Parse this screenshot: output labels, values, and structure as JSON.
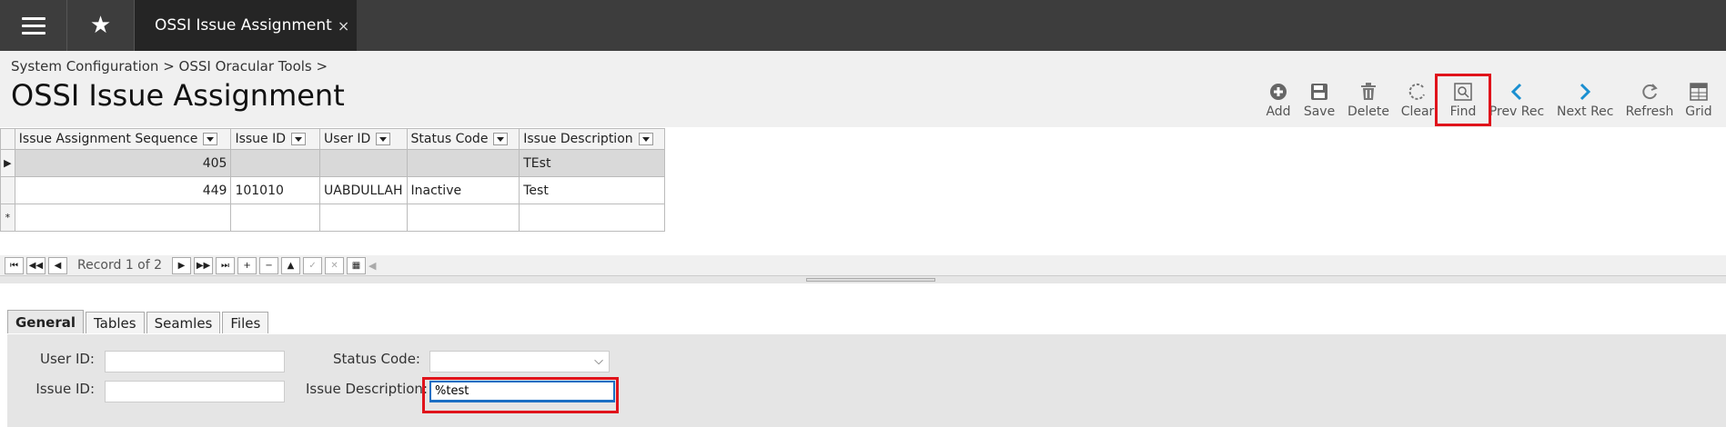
{
  "topbar": {
    "tab_label": "OSSI Issue Assignment",
    "tab_close": "×"
  },
  "header": {
    "breadcrumb": "System Configuration > OSSI Oracular Tools >",
    "title": "OSSI Issue Assignment"
  },
  "toolbar": {
    "add": "Add",
    "save": "Save",
    "delete": "Delete",
    "clear": "Clear",
    "find": "Find",
    "prev": "Prev Rec",
    "next": "Next Rec",
    "refresh": "Refresh",
    "grid": "Grid"
  },
  "grid": {
    "columns": [
      "Issue Assignment Sequence",
      "Issue ID",
      "User ID",
      "Status Code",
      "Issue Description"
    ],
    "rows": [
      {
        "seq": "405",
        "issue_id": "",
        "user_id": "",
        "status": "",
        "desc": "TEst"
      },
      {
        "seq": "449",
        "issue_id": "101010",
        "user_id": "UABDULLAH",
        "status": "Inactive",
        "desc": "Test"
      }
    ]
  },
  "recbar": {
    "label": "Record 1 of 2"
  },
  "tabs": [
    "General",
    "Tables",
    "Seamles",
    "Files"
  ],
  "form": {
    "user_id_label": "User ID:",
    "issue_id_label": "Issue ID:",
    "status_code_label": "Status Code:",
    "issue_desc_label": "Issue Description:",
    "user_id_value": "",
    "issue_id_value": "",
    "status_code_value": "",
    "issue_desc_value": "%test"
  }
}
